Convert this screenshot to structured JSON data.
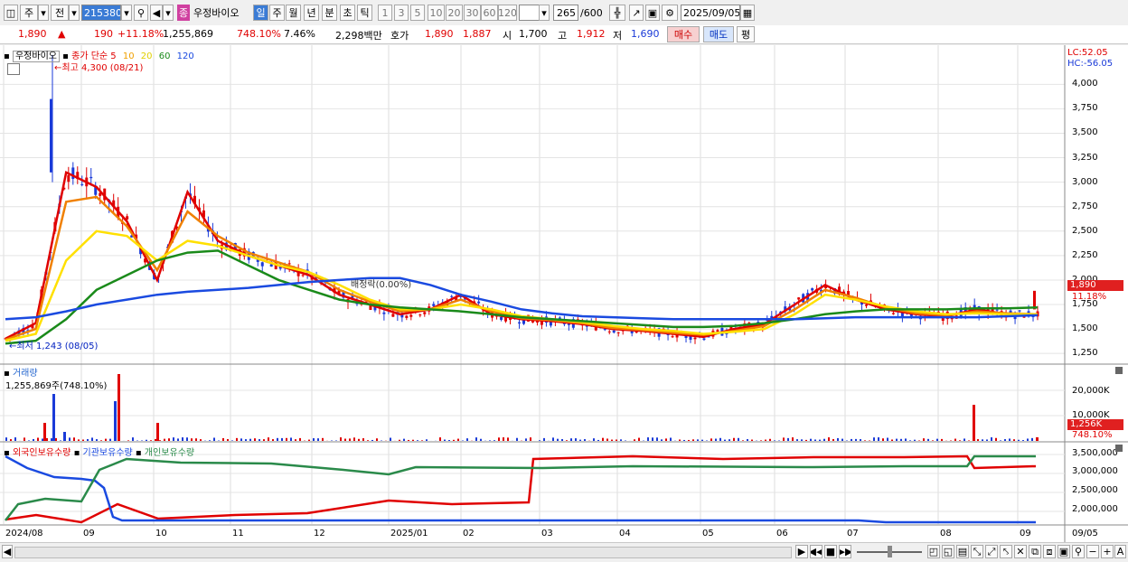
{
  "toolbar": {
    "code_value": "215380",
    "tabs": [
      "주",
      "전"
    ],
    "stock_name": "우정바이오",
    "periods": [
      "일",
      "주",
      "월",
      "년",
      "분",
      "초",
      "틱"
    ],
    "intervals": [
      "1",
      "3",
      "5",
      "10",
      "20",
      "30",
      "60",
      "120"
    ],
    "count": "265",
    "max_count": "/600",
    "date": "2025/09/05"
  },
  "quote": {
    "price": "1,890",
    "change": "190",
    "change_pct": "+11.18%",
    "volume": "1,255,869",
    "volume_ratio": "748.10%",
    "turnover": "7.46%",
    "amount": "2,298백만",
    "bid_label": "호가",
    "ask": "1,890",
    "bid": "1,887",
    "open_label": "시",
    "open": "1,700",
    "high_label": "고",
    "high": "1,912",
    "low_label": "저",
    "low": "1,690",
    "buy_button": "매수",
    "sell_button": "매도",
    "eval_button": "평"
  },
  "legend": {
    "name": "우정바이오",
    "ma_label": "종가 단순",
    "ma_periods": [
      "5",
      "10",
      "20",
      "60",
      "120"
    ],
    "ma_colors": [
      "#e00000",
      "#f08000",
      "#ffe000",
      "#1a8a1a",
      "#1a4ae0"
    ],
    "lc": "LC:52.05",
    "hc": "HC:-56.05",
    "max_note": "최고 4,300 (08/21)",
    "min_note": "최저 1,243 (08/05)",
    "rights_note": "배정락(0.00%)"
  },
  "volume_panel": {
    "title": "거래량",
    "value": "1,255,869주(748.10%)",
    "axis": [
      "20,000K",
      "10,000K"
    ],
    "current_value": "1,256K",
    "current_pct": "748.10%"
  },
  "holdings_panel": {
    "series": [
      "외국인보유수량",
      "기관보유수량",
      "개인보유수량"
    ],
    "axis": [
      "3,500,000",
      "3,000,000",
      "2,500,000",
      "2,000,000"
    ]
  },
  "price_axis": {
    "ticks": [
      "4,000",
      "3,750",
      "3,500",
      "3,250",
      "3,000",
      "2,750",
      "2,500",
      "2,250",
      "2,000",
      "1,750",
      "1,500",
      "1,250"
    ],
    "current_price": "1,890",
    "current_pct": "11.18%"
  },
  "x_axis": {
    "labels": [
      "2024/08",
      "09",
      "10",
      "11",
      "12",
      "2025/01",
      "02",
      "03",
      "04",
      "05",
      "06",
      "07",
      "08",
      "09"
    ],
    "right_label": "09/05"
  },
  "chart_data": {
    "type": "candlestick",
    "y_range": [
      1200,
      4300
    ],
    "ohlc_close_approx": [
      {
        "x": "2024/08/05",
        "low": 1243
      },
      {
        "x": "2024/08/21",
        "high": 4300
      },
      {
        "x": "2025/09/05",
        "open": 1700,
        "high": 1912,
        "low": 1690,
        "close": 1890
      }
    ],
    "series": [
      {
        "name": "5",
        "color": "#e00000",
        "values": [
          1400,
          1560,
          3100,
          2950,
          2600,
          2000,
          2900,
          2400,
          2250,
          2150,
          2050,
          1850,
          1750,
          1650,
          1700,
          1850,
          1650,
          1600,
          1580,
          1550,
          1500,
          1480,
          1450,
          1420,
          1500,
          1550,
          1750,
          1950,
          1800,
          1700,
          1650,
          1630,
          1700,
          1650,
          1650
        ]
      },
      {
        "name": "10",
        "color": "#f08000",
        "values": [
          1390,
          1500,
          2800,
          2850,
          2550,
          2100,
          2700,
          2450,
          2280,
          2180,
          2080,
          1900,
          1780,
          1680,
          1700,
          1800,
          1680,
          1610,
          1590,
          1560,
          1510,
          1490,
          1460,
          1440,
          1480,
          1530,
          1700,
          1900,
          1820,
          1720,
          1660,
          1640,
          1680,
          1660,
          1650
        ]
      },
      {
        "name": "20",
        "color": "#ffe000",
        "values": [
          1380,
          1450,
          2200,
          2500,
          2450,
          2200,
          2400,
          2350,
          2250,
          2150,
          2080,
          1950,
          1800,
          1700,
          1700,
          1750,
          1700,
          1630,
          1600,
          1570,
          1530,
          1500,
          1480,
          1450,
          1470,
          1500,
          1650,
          1850,
          1800,
          1730,
          1680,
          1650,
          1660,
          1650,
          1650
        ]
      },
      {
        "name": "60",
        "color": "#1a8a1a",
        "values": [
          1350,
          1380,
          1600,
          1900,
          2050,
          2200,
          2280,
          2300,
          2150,
          2000,
          1900,
          1800,
          1750,
          1720,
          1700,
          1680,
          1650,
          1620,
          1600,
          1580,
          1560,
          1540,
          1520,
          1520,
          1530,
          1560,
          1600,
          1650,
          1680,
          1700,
          1700,
          1700,
          1710,
          1710,
          1720
        ]
      },
      {
        "name": "120",
        "color": "#1a4ae0",
        "values": [
          1600,
          1620,
          1680,
          1750,
          1800,
          1850,
          1880,
          1900,
          1920,
          1950,
          1980,
          2000,
          2020,
          2020,
          1950,
          1850,
          1780,
          1700,
          1660,
          1630,
          1620,
          1610,
          1600,
          1600,
          1600,
          1600,
          1600,
          1610,
          1620,
          1620,
          1620,
          1620,
          1620,
          1630,
          1640
        ]
      }
    ],
    "holdings": [
      {
        "name": "외국인보유수량",
        "color": "#e00000"
      },
      {
        "name": "기관보유수량",
        "color": "#1a4ae0"
      },
      {
        "name": "개인보유수량",
        "color": "#2a8a4a"
      }
    ]
  }
}
